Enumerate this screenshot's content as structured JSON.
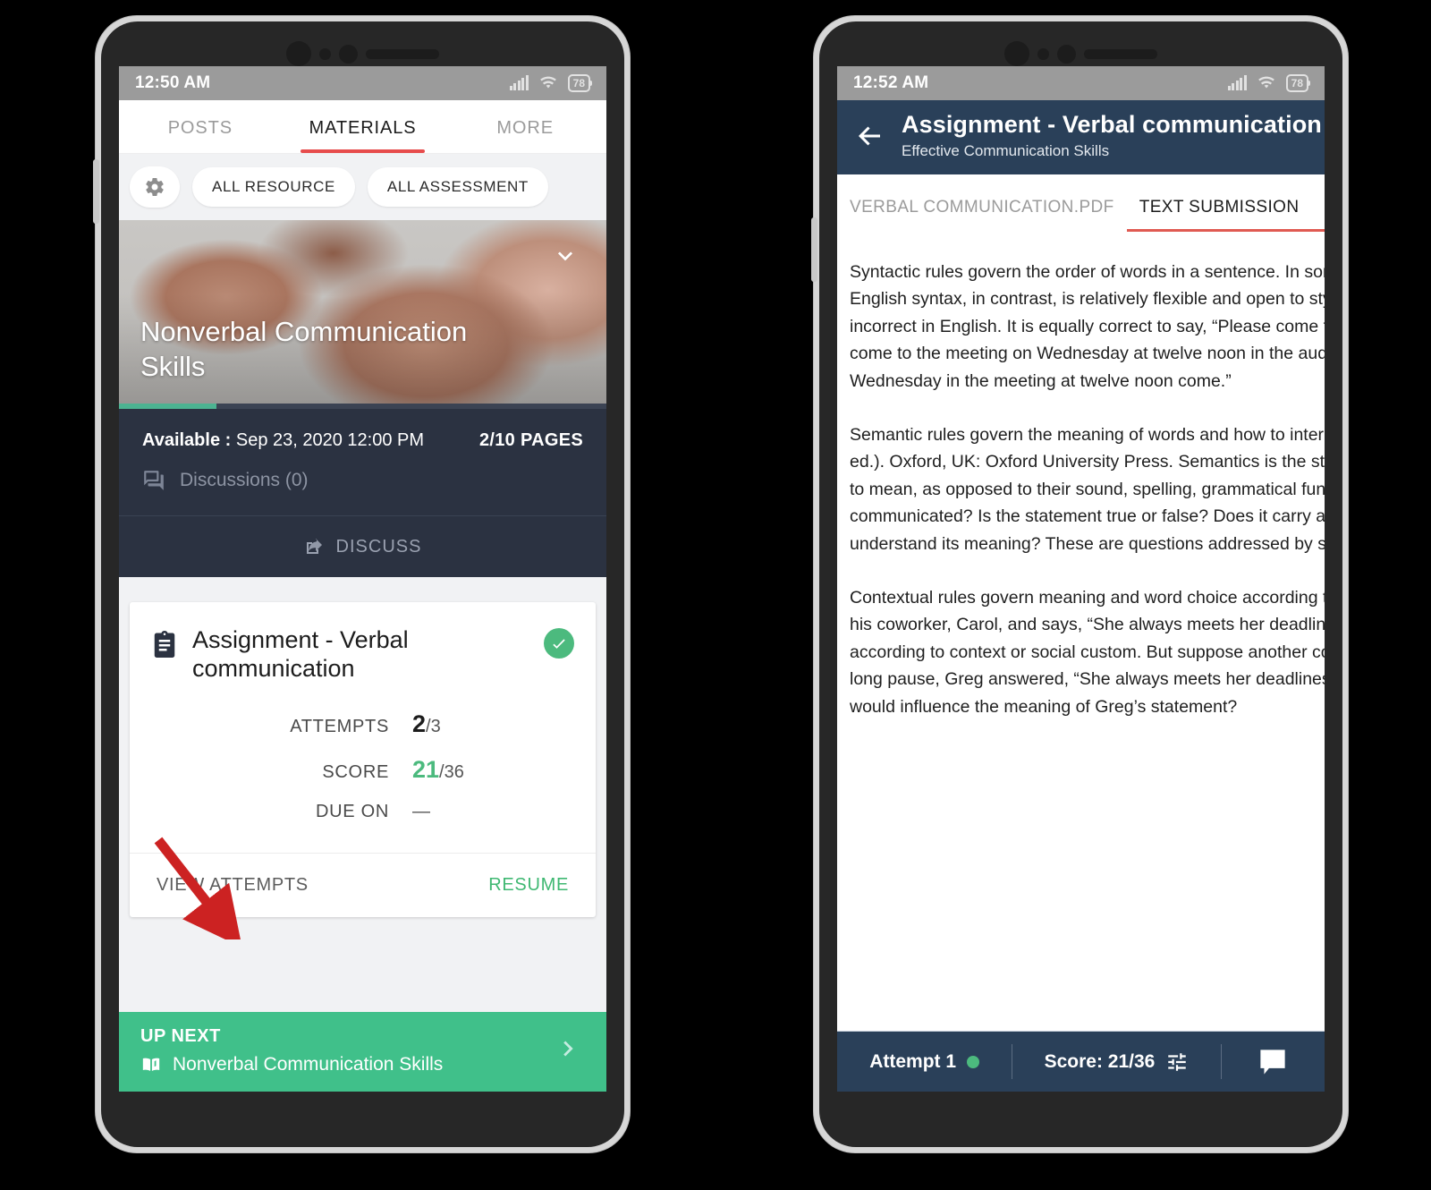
{
  "left_phone": {
    "status_bar": {
      "time": "12:50 AM",
      "battery": "78",
      "signal_icon": "signal-bars-icon",
      "wifi_icon": "wifi-icon",
      "battery_icon": "battery-icon"
    },
    "tabs": [
      {
        "label": "POSTS",
        "active": false
      },
      {
        "label": "MATERIALS",
        "active": true
      },
      {
        "label": "MORE",
        "active": false
      }
    ],
    "filters": {
      "gear_icon": "gear-icon",
      "chips": [
        "ALL RESOURCE",
        "ALL ASSESSMENT"
      ]
    },
    "media_card": {
      "title": "Nonverbal Communication Skills",
      "chevron_icon": "chevron-down-icon",
      "progress_percent": 20,
      "available_label": "Available :",
      "available_value": "Sep 23, 2020 12:00 PM",
      "pages": "2/10 PAGES",
      "discussions": "Discussions (0)",
      "discussions_icon": "comment-icon",
      "discuss_button": "DISCUSS",
      "discuss_icon": "share-icon"
    },
    "assignment_card": {
      "icon": "clipboard-icon",
      "title": "Assignment - Verbal communication",
      "status_icon": "check-circle-icon",
      "stats": [
        {
          "label": "ATTEMPTS",
          "value": "2",
          "suffix": "/3",
          "highlight": false
        },
        {
          "label": "SCORE",
          "value": "21",
          "suffix": "/36",
          "highlight": true
        },
        {
          "label": "DUE ON",
          "value": "—",
          "suffix": "",
          "highlight": false
        }
      ],
      "action_left": "VIEW ATTEMPTS",
      "action_right": "RESUME"
    },
    "up_next": {
      "kicker": "UP NEXT",
      "title": "Nonverbal Communication Skills",
      "book_icon": "book-icon",
      "chevron_icon": "chevron-right-icon"
    }
  },
  "right_phone": {
    "status_bar": {
      "time": "12:52 AM",
      "battery": "78",
      "signal_icon": "signal-bars-icon",
      "wifi_icon": "wifi-icon",
      "battery_icon": "battery-icon"
    },
    "app_bar": {
      "back_icon": "back-arrow-icon",
      "title": "Assignment - Verbal communication",
      "subtitle": "Effective Communication Skills"
    },
    "doc_tabs": [
      {
        "label": "VERBAL COMMUNICATION.PDF",
        "active": false
      },
      {
        "label": "TEXT SUBMISSION",
        "active": true
      }
    ],
    "submission": {
      "paragraphs": [
        [
          "Syntactic rules govern the order of words in a sentence. In some lan",
          "English syntax, in contrast, is relatively flexible and open to style. Sti",
          "incorrect in English. It is equally correct to say, “Please come to the",
          "come to the meeting on Wednesday at twelve noon in the auditoriun",
          "Wednesday in the meeting at twelve noon come.”"
        ],
        [
          "Semantic rules govern the meaning of words and how to interpret th",
          "ed.). Oxford, UK: Oxford University Press. Semantics is the study of",
          "to mean, as opposed to their sound, spelling, grammatical function,",
          "communicated? Is the statement true or false? Does it carry a certa",
          "understand its meaning? These are questions addressed by semant"
        ],
        [
          "Contextual rules govern meaning and word choice according to con",
          "his coworker, Carol, and says, “She always meets her deadlines.” Thi",
          "according to context or social custom. But suppose another cowork",
          "long pause, Greg answered, “She always meets her deadlines.” Are t",
          "would influence the meaning of Greg’s statement?"
        ]
      ]
    },
    "bottom_bar": {
      "attempt": "Attempt 1",
      "attempt_dot_icon": "status-dot-icon",
      "score": "Score: 21/36",
      "tune_icon": "tune-icon",
      "chat_icon": "chat-bubble-icon"
    }
  },
  "annotation": {
    "arrow_color": "#cc2222",
    "arrow_icon": "red-arrow-annotation"
  },
  "colors": {
    "accent_red": "#e74c4c",
    "green": "#4cba7e",
    "up_next_green": "#40c08a",
    "dark_navy": "#2b3241",
    "app_bar_navy": "#2a4059"
  }
}
